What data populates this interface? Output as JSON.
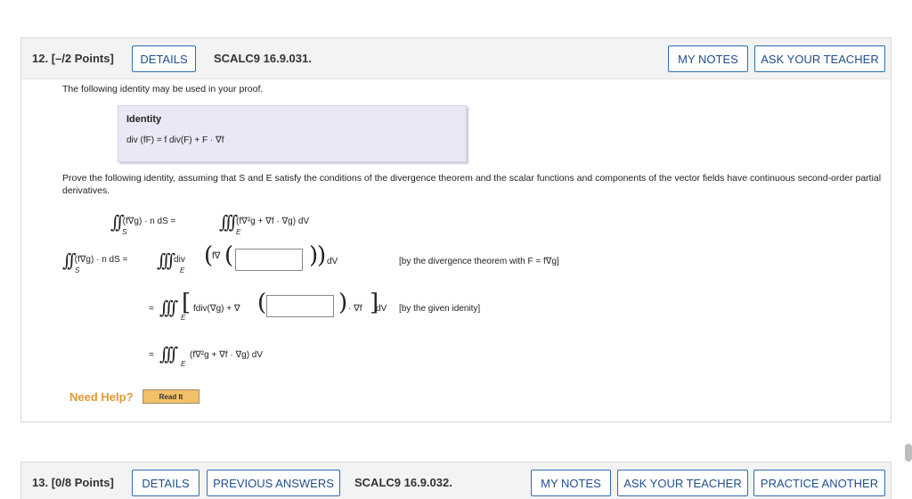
{
  "q12": {
    "number": "12.",
    "points": "[–/2 Points]",
    "details_label": "DETAILS",
    "code": "SCALC9 16.9.031.",
    "my_notes_label": "MY NOTES",
    "ask_label": "ASK YOUR TEACHER",
    "intro": "The following identity may be used in your proof.",
    "identity_title": "Identity",
    "identity_formula": "div (fF) = f div(F) + F · ∇f",
    "prove_text": "Prove the following identity, assuming that S and E satisfy the conditions of the divergence theorem and the scalar functions and components of the vector fields have continuous second-order partial derivatives.",
    "eq_main_left": "(f∇g) · n dS =",
    "eq_main_right": "(f∇²g + ∇f · ∇g) dV",
    "step1_left": "(f∇g) · n dS =",
    "step1_div": "div",
    "step1_fnabla": "f∇",
    "step1_dv": "dV",
    "step1_note": "[by the divergence theorem with F = f∇g]",
    "step2_eq": "=",
    "step2_inner": "fdiv(∇g) + ∇",
    "step2_tail": "· ∇f",
    "step2_dv": "dV",
    "step2_note": "[by the given idenity]",
    "step3_eq": "=",
    "step3_expr": "(f∇²g + ∇f · ∇g) dV",
    "sub_S": "S",
    "sub_E": "E",
    "answer1_value": "",
    "answer2_value": "",
    "need_help": "Need Help?",
    "read_it": "Read It"
  },
  "q13": {
    "number": "13.",
    "points": "[0/8 Points]",
    "details_label": "DETAILS",
    "previous_label": "PREVIOUS ANSWERS",
    "code": "SCALC9 16.9.032.",
    "my_notes_label": "MY NOTES",
    "ask_label": "ASK YOUR TEACHER",
    "practice_label": "PRACTICE ANOTHER"
  },
  "colors": {
    "button_border": "#2f6db3",
    "button_text": "#1f4e8c",
    "need_help": "#e2983a",
    "read_it_bg": "#f3c06a",
    "identity_bg": "#e8e8f6"
  }
}
